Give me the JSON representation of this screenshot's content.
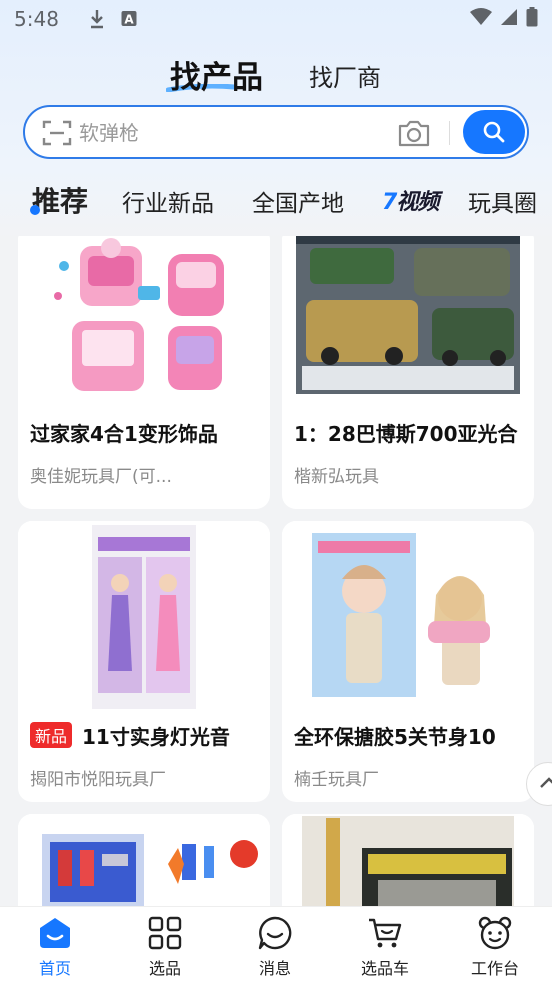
{
  "status_bar": {
    "time": "5:48"
  },
  "mode_tabs": {
    "active": "找产品",
    "other": "找厂商"
  },
  "search": {
    "placeholder": "软弹枪"
  },
  "category_tabs": {
    "items": [
      "推荐",
      "行业新品",
      "全国产地",
      "玩具圈"
    ],
    "video_logo": "视频"
  },
  "products": [
    {
      "title": "过家家4合1变形饰品",
      "seller": "奥佳妮玩具厂(可..."
    },
    {
      "title": "1：28巴博斯700亚光合",
      "seller": "楷新弘玩具"
    },
    {
      "tag": "新品",
      "title": "11寸实身灯光音",
      "seller": "揭阳市悦阳玩具厂"
    },
    {
      "title": "全环保搪胶5关节身10",
      "seller": "楠壬玩具厂"
    }
  ],
  "bottom_nav": [
    {
      "label": "首页"
    },
    {
      "label": "选品"
    },
    {
      "label": "消息"
    },
    {
      "label": "选品车"
    },
    {
      "label": "工作台"
    }
  ],
  "colors": {
    "accent": "#1677ff",
    "tag_red": "#ee2b2b"
  }
}
